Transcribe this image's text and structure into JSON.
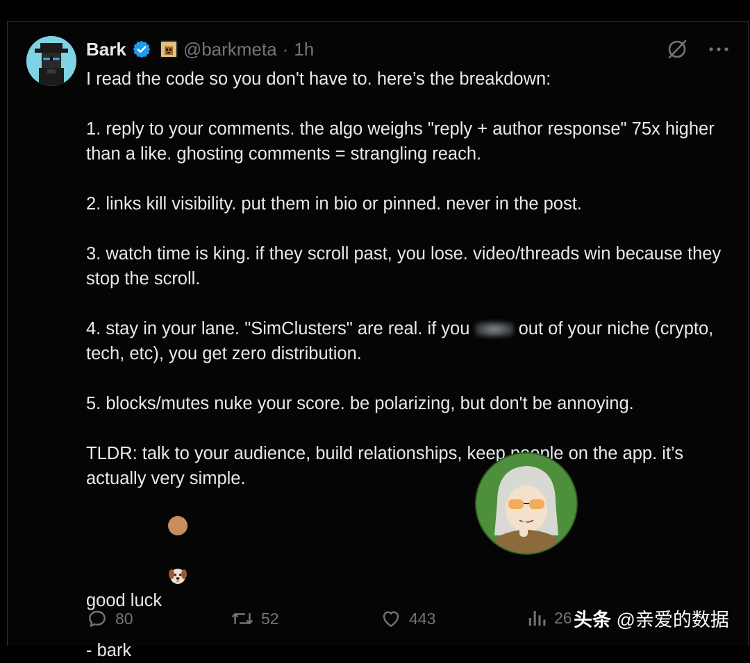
{
  "tweet": {
    "author_name": "Bark",
    "handle": "@barkmeta",
    "separator": "·",
    "time": "1h",
    "paragraphs": [
      "I read the code so you don't have to. here’s the breakdown:",
      "1. reply to your comments. the algo weighs \"reply + author response\" 75x higher than a like. ghosting comments = strangling reach.",
      "2. links kill visibility. put them in bio or pinned. never in the post.",
      "3. watch time is king. if they scroll past, you lose. video/threads win because they stop the scroll.",
      "4. stay in your lane. \"SimClusters\" are real. if you",
      "out of your niche (crypto, tech, etc), you get zero distribution.",
      "5. blocks/mutes nuke your score. be polarizing, but don't be annoying.",
      "TLDR: talk to your audience, build relationships, keep people on the app. it’s actually very simple.",
      "good luck",
      "- bark"
    ]
  },
  "actions": {
    "replies": "80",
    "reposts": "52",
    "likes": "443",
    "views": "26"
  },
  "watermark": {
    "brand": "头条",
    "account": "@亲爱的数据"
  },
  "icons": {
    "verified": "verified-badge-icon",
    "grok": "grok-icon",
    "more": "more-icon",
    "reply": "reply-icon",
    "repost": "repost-icon",
    "like": "like-icon",
    "views": "views-icon"
  },
  "colors": {
    "background": "#000000",
    "text": "#e7e9ea",
    "muted": "#71767b",
    "verified": "#1d9bf0"
  }
}
